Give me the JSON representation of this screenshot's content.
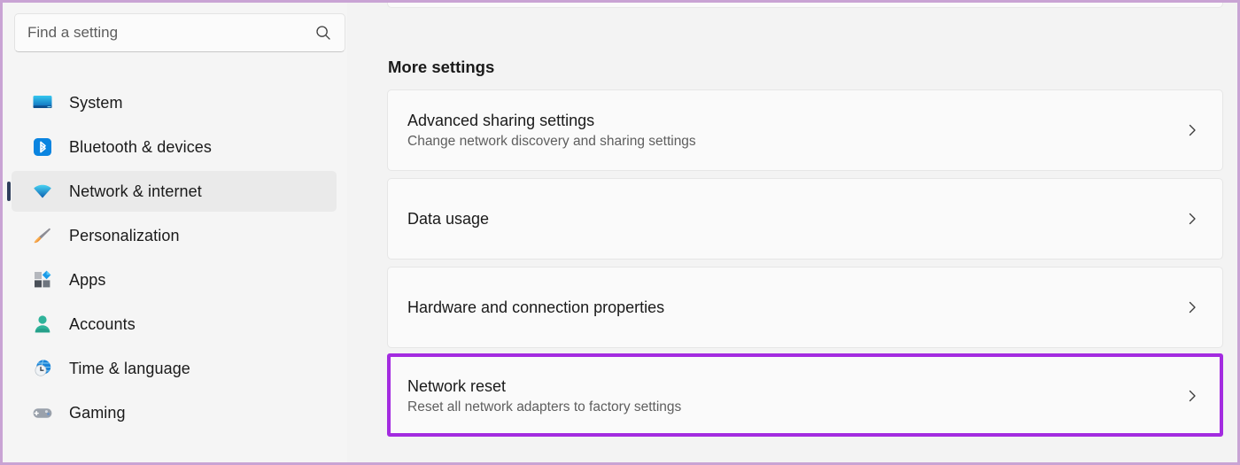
{
  "window": {
    "app": "Windows Settings",
    "outer_frame_color": "#c9a3d4"
  },
  "search": {
    "placeholder": "Find a setting",
    "value": "",
    "icon": "search-icon"
  },
  "sidebar": {
    "selected": "Network & internet",
    "accent_color": "#2f3f5c",
    "items": [
      {
        "label": "System",
        "icon": "monitor-icon",
        "selected": false
      },
      {
        "label": "Bluetooth & devices",
        "icon": "bluetooth-icon",
        "selected": false
      },
      {
        "label": "Network & internet",
        "icon": "wifi-icon",
        "selected": true
      },
      {
        "label": "Personalization",
        "icon": "paintbrush-icon",
        "selected": false
      },
      {
        "label": "Apps",
        "icon": "apps-grid-icon",
        "selected": false
      },
      {
        "label": "Accounts",
        "icon": "person-icon",
        "selected": false
      },
      {
        "label": "Time & language",
        "icon": "globe-clock-icon",
        "selected": false
      },
      {
        "label": "Gaming",
        "icon": "gamepad-icon",
        "selected": false
      }
    ]
  },
  "main": {
    "section_heading": "More settings",
    "cards": [
      {
        "title": "Advanced sharing settings",
        "subtitle": "Change network discovery and sharing settings",
        "chevron": "chevron-right-icon",
        "highlighted": false
      },
      {
        "title": "Data usage",
        "subtitle": "",
        "chevron": "chevron-right-icon",
        "highlighted": false
      },
      {
        "title": "Hardware and connection properties",
        "subtitle": "",
        "chevron": "chevron-right-icon",
        "highlighted": false
      },
      {
        "title": "Network reset",
        "subtitle": "Reset all network adapters to factory settings",
        "chevron": "chevron-right-icon",
        "highlighted": true
      }
    ]
  },
  "annotation": {
    "target": "Network reset",
    "color": "#a32be0"
  }
}
